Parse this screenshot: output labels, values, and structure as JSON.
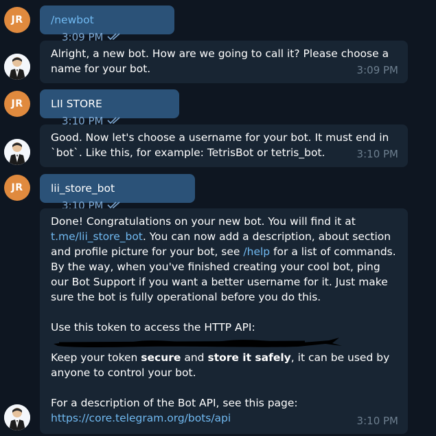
{
  "chat": {
    "user_initials": "JR",
    "messages": [
      {
        "sender": "user",
        "text": "/newbot",
        "time": "3:09 PM",
        "read": true
      },
      {
        "sender": "bot",
        "text": "Alright, a new bot. How are we going to call it? Please choose a name for your bot.",
        "time": "3:09 PM"
      },
      {
        "sender": "user",
        "text": "LII STORE",
        "time": "3:10 PM",
        "read": true
      },
      {
        "sender": "bot",
        "text": "Good. Now let's choose a username for your bot. It must end in `bot`. Like this, for example: TetrisBot or tetris_bot.",
        "time": "3:10 PM"
      },
      {
        "sender": "user",
        "text": "lii_store_bot",
        "time": "3:10 PM",
        "read": true
      },
      {
        "sender": "bot",
        "time": "3:10 PM",
        "p1_a": "Done! Congratulations on your new bot. You will find it at",
        "p1_link1": "t.me/lii_store_bot",
        "p1_b": ". You can now add a description, about section and profile picture for your bot, see",
        "p1_link2": "/help",
        "p1_c": "for a list of commands. By the way, when you've finished creating your cool bot, ping our Bot Support if you want a better username for it. Just make sure the bot is fully operational before you do this.",
        "p2": "Use this token to access the HTTP API:",
        "p3_a": "Keep your token",
        "p3_b1": "secure",
        "p3_b": "and",
        "p3_b2": "store it safely",
        "p3_c": ", it can be used by anyone to control your bot.",
        "p4": "For a description of the Bot API, see this page:",
        "p4_link": "https://core.telegram.org/bots/api"
      }
    ]
  },
  "colors": {
    "background": "#0e1621",
    "outgoing_bubble": "#2b5278",
    "incoming_bubble": "#182533",
    "avatar_user": "#e08a3e",
    "link": "#71baf2",
    "time_incoming": "#6d7f8f",
    "time_outgoing": "#7da8d3"
  },
  "icons": {
    "read_status": "double-check-icon",
    "bot_avatar": "botfather-avatar-icon"
  }
}
